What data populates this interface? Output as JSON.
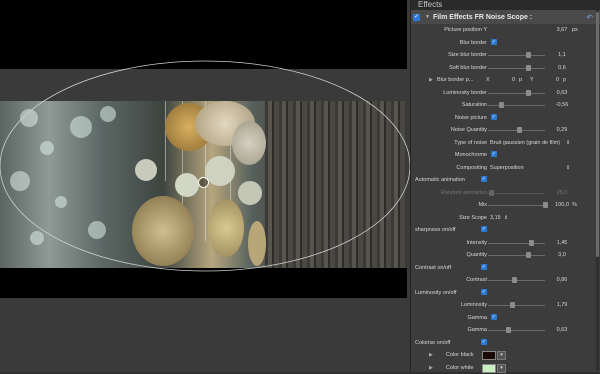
{
  "panel": {
    "header": "Effects",
    "effect_name": "Film Effects FR Noise Scope :",
    "reset_glyph": "↶",
    "check_glyph": "✓",
    "rows": [
      {
        "type": "value",
        "label": "Picture position Y",
        "value": "3,67",
        "unit": "px"
      },
      {
        "type": "check",
        "label": "Blur border"
      },
      {
        "type": "slider",
        "label": "Size blur border",
        "value": "1,1",
        "level": 0.7
      },
      {
        "type": "slider",
        "label": "Soft blur border",
        "value": "0,6",
        "level": 0.7
      },
      {
        "type": "pair",
        "label": "Blur border p...",
        "x_label": "X",
        "x_value": "0",
        "x_unit": "p",
        "y_label": "Y",
        "y_value": "0",
        "y_unit": "p"
      },
      {
        "type": "slider",
        "label": "Luminosity border",
        "value": "0,63",
        "level": 0.7
      },
      {
        "type": "slider",
        "label": "Saturation",
        "value": "-0,56",
        "level": 0.22
      },
      {
        "type": "check",
        "label": "Noise picture"
      },
      {
        "type": "slider",
        "label": "Noise Quantity",
        "value": "0,29",
        "level": 0.55
      },
      {
        "type": "select",
        "label": "Type of noise",
        "value": "Bruit gaussien (grain de film)",
        "arrow": "⇕"
      },
      {
        "type": "check",
        "label": "Monochrome"
      },
      {
        "type": "select",
        "label": "Compositing",
        "value": "Superposition",
        "arrow": "⇕"
      },
      {
        "type": "checkleft",
        "label": "Automatic animation"
      },
      {
        "type": "slider",
        "label": "Random animation",
        "value": "25,0",
        "level": 0.05,
        "disabled": true
      },
      {
        "type": "slider",
        "label": "Mix",
        "value": "100,0",
        "level": 1.0,
        "unit": "%"
      },
      {
        "type": "select",
        "label": "Size Scope",
        "value": "3,15",
        "arrow": "⇕"
      },
      {
        "type": "checkleft",
        "label": "sharpness on/off"
      },
      {
        "type": "slider",
        "label": "Intensity",
        "value": "1,45",
        "level": 0.75
      },
      {
        "type": "slider",
        "label": "Quantity",
        "value": "3,0",
        "level": 0.7
      },
      {
        "type": "checkleft",
        "label": "Contrast on/off"
      },
      {
        "type": "slider",
        "label": "Contrast",
        "value": "0,86",
        "level": 0.45
      },
      {
        "type": "checkleft",
        "label": "Luminosity on/off"
      },
      {
        "type": "slider",
        "label": "Luminosity",
        "value": "1,79",
        "level": 0.42
      },
      {
        "type": "check",
        "label": "Gamma"
      },
      {
        "type": "slider",
        "label": "Gamma",
        "value": "0,63",
        "level": 0.35
      },
      {
        "type": "checkleft",
        "label": "Colorise on/off"
      },
      {
        "type": "color",
        "label": "Color black",
        "color": "#1a0a06",
        "arrow": "▾"
      },
      {
        "type": "color",
        "label": "Color white",
        "color": "#c8f0c0",
        "arrow": "▾"
      }
    ]
  },
  "colors": {
    "accent": "#2b79d6"
  }
}
